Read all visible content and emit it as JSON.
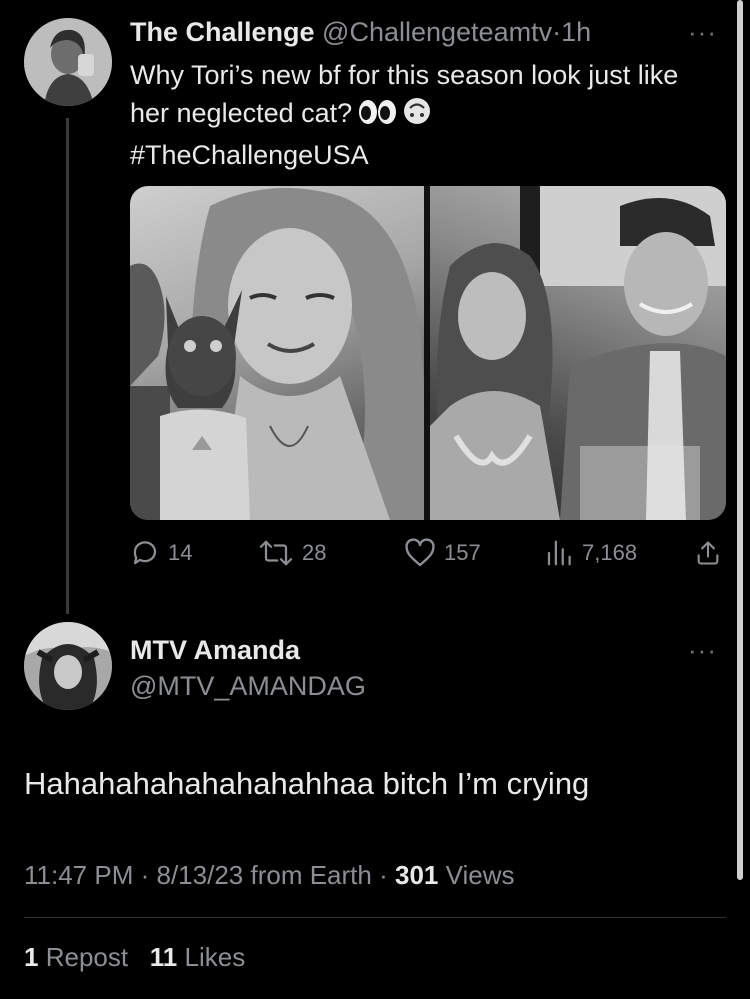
{
  "tweet": {
    "display_name": "The Challenge",
    "handle": "@Challengeteamtv",
    "separator": "·",
    "time": "1h",
    "more": "···",
    "text": "Why Tori’s new bf for this season look just like her neglected cat?",
    "emoji_eyes": "👀",
    "emoji_face": "🙃",
    "hashtag": "#TheChallengeUSA",
    "replies": "14",
    "reposts": "28",
    "likes": "157",
    "views": "7,168"
  },
  "reply": {
    "display_name": "MTV Amanda",
    "handle": "@MTV_AMANDAG",
    "more": "···",
    "text": "Hahahahahahahahahhaa bitch I’m crying",
    "time": "11:47 PM",
    "date": "8/13/23",
    "source": "from Earth",
    "sep": "·",
    "views_count": "301",
    "views_label": "Views",
    "reposts_count": "1",
    "reposts_label": "Repost",
    "likes_count": "11",
    "likes_label": "Likes"
  },
  "icons": {
    "reply": "reply-icon",
    "repost": "repost-icon",
    "like": "heart-icon",
    "views": "views-icon",
    "share": "share-icon"
  }
}
